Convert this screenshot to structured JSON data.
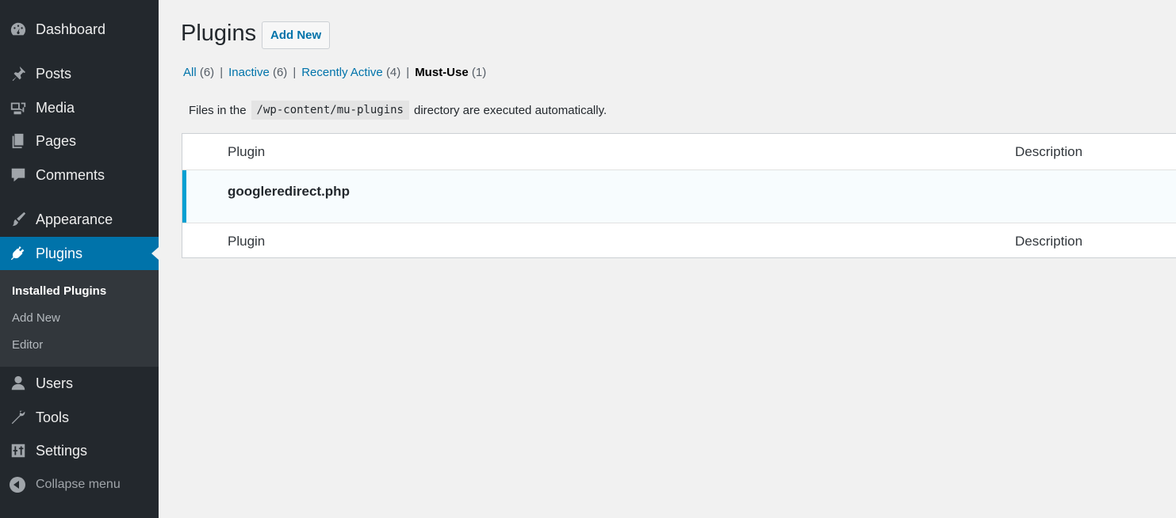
{
  "sidebar": {
    "menu": [
      {
        "label": "Dashboard",
        "icon": "dashboard-icon"
      },
      {
        "label": "Posts",
        "icon": "pin-icon"
      },
      {
        "label": "Media",
        "icon": "media-icon"
      },
      {
        "label": "Pages",
        "icon": "pages-icon"
      },
      {
        "label": "Comments",
        "icon": "comment-icon"
      },
      {
        "label": "Appearance",
        "icon": "brush-icon"
      },
      {
        "label": "Plugins",
        "icon": "plug-icon"
      },
      {
        "label": "Users",
        "icon": "user-icon"
      },
      {
        "label": "Tools",
        "icon": "wrench-icon"
      },
      {
        "label": "Settings",
        "icon": "sliders-icon"
      }
    ],
    "submenu": [
      {
        "label": "Installed Plugins"
      },
      {
        "label": "Add New"
      },
      {
        "label": "Editor"
      }
    ],
    "collapse_label": "Collapse menu",
    "colors": {
      "background": "#23282d",
      "active": "#0073aa",
      "submenu": "#32373c"
    }
  },
  "main": {
    "title": "Plugins",
    "add_new_label": "Add New",
    "views": [
      {
        "label": "All",
        "count": "(6)"
      },
      {
        "label": "Inactive",
        "count": "(6)"
      },
      {
        "label": "Recently Active",
        "count": "(4)"
      },
      {
        "label": "Must-Use",
        "count": "(1)"
      }
    ],
    "notice": {
      "before": "Files in the",
      "code": "/wp-content/mu-plugins",
      "after": "directory are executed automatically."
    },
    "table": {
      "columns": [
        "Plugin",
        "Description"
      ],
      "rows": [
        {
          "name": "googleredirect.php",
          "description": ""
        }
      ]
    },
    "colors": {
      "link": "#0073aa",
      "active_row_bar": "#00a0d2"
    }
  }
}
